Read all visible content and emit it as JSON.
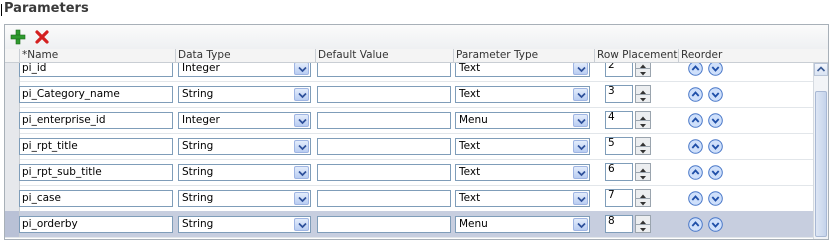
{
  "section": {
    "title": "Parameters"
  },
  "toolbar": {
    "add_icon": "add-icon",
    "delete_icon": "delete-icon"
  },
  "columns": [
    "*Name",
    "Data Type",
    "Default Value",
    "Parameter Type",
    "Row Placement",
    "Reorder"
  ],
  "rows": [
    {
      "name": "pi_id",
      "data_type": "Integer",
      "default_value": "",
      "parameter_type": "Text",
      "row_placement": "2",
      "selected": false
    },
    {
      "name": "pi_Category_name",
      "data_type": "String",
      "default_value": "",
      "parameter_type": "Text",
      "row_placement": "3",
      "selected": false
    },
    {
      "name": "pi_enterprise_id",
      "data_type": "Integer",
      "default_value": "",
      "parameter_type": "Menu",
      "row_placement": "4",
      "selected": false
    },
    {
      "name": "pi_rpt_title",
      "data_type": "String",
      "default_value": "",
      "parameter_type": "Text",
      "row_placement": "5",
      "selected": false
    },
    {
      "name": "pi_rpt_sub_title",
      "data_type": "String",
      "default_value": "",
      "parameter_type": "Text",
      "row_placement": "6",
      "selected": false
    },
    {
      "name": "pi_case",
      "data_type": "String",
      "default_value": "",
      "parameter_type": "Text",
      "row_placement": "7",
      "selected": false
    },
    {
      "name": "pi_orderby",
      "data_type": "String",
      "default_value": "",
      "parameter_type": "Menu",
      "row_placement": "8",
      "selected": true
    }
  ],
  "colors": {
    "selected_row": "#c7cedf",
    "input_border": "#7f9db9",
    "accent_blue": "#2e6fd8"
  }
}
